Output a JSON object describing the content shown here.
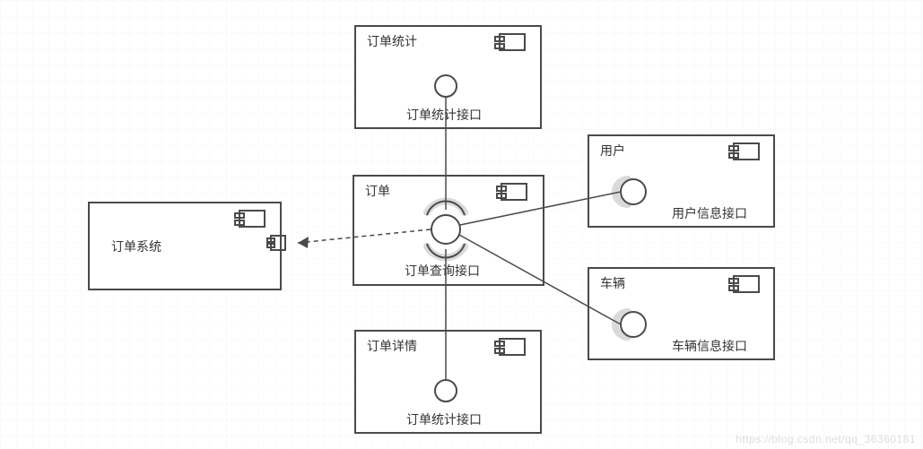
{
  "components": {
    "order_stats": {
      "title": "订单统计",
      "interface": "订单统计接口"
    },
    "order": {
      "title": "订单",
      "interface": "订单查询接口"
    },
    "order_detail": {
      "title": "订单详情",
      "interface": "订单统计接口"
    },
    "user": {
      "title": "用户",
      "interface": "用户信息接口"
    },
    "vehicle": {
      "title": "车辆",
      "interface": "车辆信息接口"
    },
    "order_system": {
      "title": "订单系统"
    }
  },
  "watermark": "https://blog.csdn.net/qq_36360181"
}
